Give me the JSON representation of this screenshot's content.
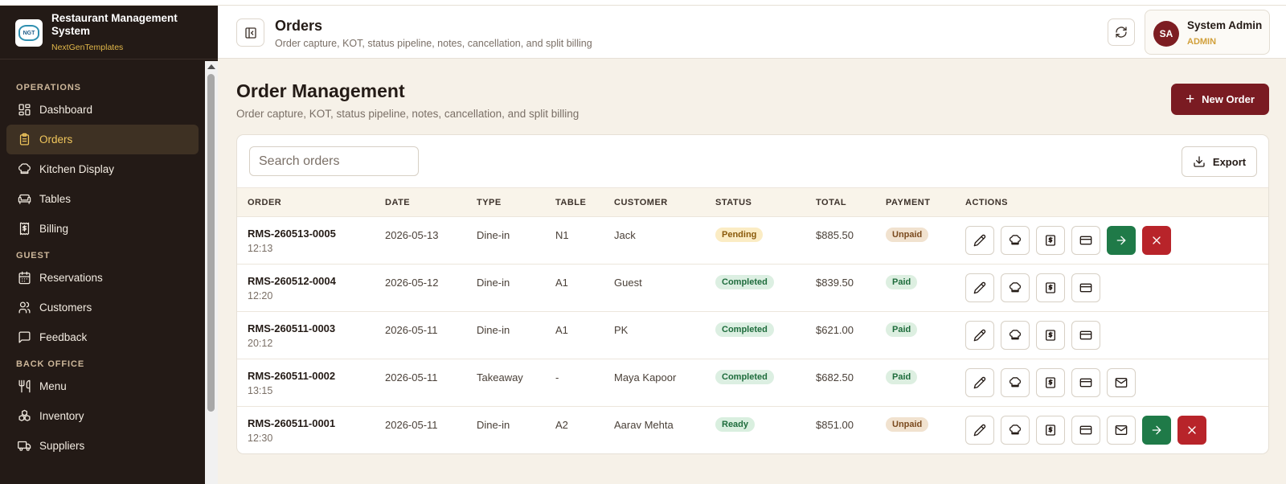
{
  "brand": {
    "title": "Restaurant Management System",
    "subtitle": "NextGenTemplates",
    "logo_text": "NGT"
  },
  "sidebar": {
    "sections": [
      {
        "label": "OPERATIONS",
        "items": [
          {
            "label": "Dashboard",
            "icon": "dashboard-icon"
          },
          {
            "label": "Orders",
            "icon": "clipboard-icon",
            "active": true
          },
          {
            "label": "Kitchen Display",
            "icon": "chef-hat-icon"
          },
          {
            "label": "Tables",
            "icon": "sofa-icon"
          },
          {
            "label": "Billing",
            "icon": "receipt-dollar-icon"
          }
        ]
      },
      {
        "label": "GUEST",
        "items": [
          {
            "label": "Reservations",
            "icon": "calendar-icon"
          },
          {
            "label": "Customers",
            "icon": "users-icon"
          },
          {
            "label": "Feedback",
            "icon": "message-square-icon"
          }
        ]
      },
      {
        "label": "BACK OFFICE",
        "items": [
          {
            "label": "Menu",
            "icon": "utensils-icon"
          },
          {
            "label": "Inventory",
            "icon": "boxes-icon"
          },
          {
            "label": "Suppliers",
            "icon": "truck-icon"
          }
        ]
      }
    ]
  },
  "header": {
    "title": "Orders",
    "subtitle": "Order capture, KOT, status pipeline, notes, cancellation, and split billing",
    "user": {
      "initials": "SA",
      "name": "System Admin",
      "role": "ADMIN"
    }
  },
  "page": {
    "title": "Order Management",
    "subtitle": "Order capture, KOT, status pipeline, notes, cancellation, and split billing",
    "new_order_label": "New Order",
    "search_placeholder": "Search orders",
    "export_label": "Export"
  },
  "table": {
    "columns": [
      "ORDER",
      "DATE",
      "TYPE",
      "TABLE",
      "CUSTOMER",
      "STATUS",
      "TOTAL",
      "PAYMENT",
      "ACTIONS"
    ],
    "rows": [
      {
        "order": "RMS-260513-0005",
        "time": "12:13",
        "date": "2026-05-13",
        "type": "Dine-in",
        "table": "N1",
        "customer": "Jack",
        "status": "Pending",
        "status_kind": "pending",
        "total": "$885.50",
        "payment": "Unpaid",
        "payment_kind": "unpaid",
        "actions": [
          "edit",
          "kitchen",
          "bill",
          "card",
          "advance",
          "cancel"
        ]
      },
      {
        "order": "RMS-260512-0004",
        "time": "12:20",
        "date": "2026-05-12",
        "type": "Dine-in",
        "table": "A1",
        "customer": "Guest",
        "status": "Completed",
        "status_kind": "completed",
        "total": "$839.50",
        "payment": "Paid",
        "payment_kind": "paid",
        "actions": [
          "edit",
          "kitchen",
          "bill",
          "card"
        ]
      },
      {
        "order": "RMS-260511-0003",
        "time": "20:12",
        "date": "2026-05-11",
        "type": "Dine-in",
        "table": "A1",
        "customer": "PK",
        "status": "Completed",
        "status_kind": "completed",
        "total": "$621.00",
        "payment": "Paid",
        "payment_kind": "paid",
        "actions": [
          "edit",
          "kitchen",
          "bill",
          "card"
        ]
      },
      {
        "order": "RMS-260511-0002",
        "time": "13:15",
        "date": "2026-05-11",
        "type": "Takeaway",
        "table": "-",
        "customer": "Maya Kapoor",
        "status": "Completed",
        "status_kind": "completed",
        "total": "$682.50",
        "payment": "Paid",
        "payment_kind": "paid",
        "actions": [
          "edit",
          "kitchen",
          "bill",
          "card",
          "email"
        ]
      },
      {
        "order": "RMS-260511-0001",
        "time": "12:30",
        "date": "2026-05-11",
        "type": "Dine-in",
        "table": "A2",
        "customer": "Aarav Mehta",
        "status": "Ready",
        "status_kind": "ready",
        "total": "$851.00",
        "payment": "Unpaid",
        "payment_kind": "unpaid",
        "actions": [
          "edit",
          "kitchen",
          "bill",
          "card",
          "email",
          "advance",
          "cancel"
        ]
      }
    ]
  },
  "colors": {
    "sidebar_bg": "#231a16",
    "accent": "#7a1b22",
    "active_text": "#f0c65c",
    "success": "#1f7a48",
    "danger": "#b8242a"
  }
}
